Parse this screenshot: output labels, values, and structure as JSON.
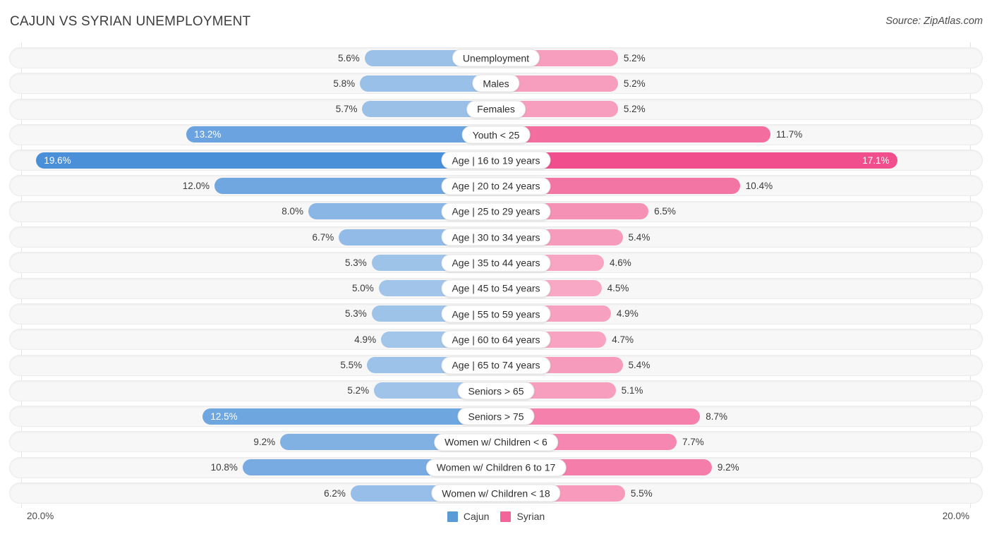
{
  "header": {
    "title": "CAJUN VS SYRIAN UNEMPLOYMENT",
    "source": "Source: ZipAtlas.com"
  },
  "axis": {
    "left_tick": "20.0%",
    "right_tick": "20.0%",
    "max": 20.0
  },
  "legend": {
    "items": [
      {
        "label": "Cajun",
        "color": "#5B9BD5"
      },
      {
        "label": "Syrian",
        "color": "#F2659B"
      }
    ]
  },
  "chart_data": {
    "type": "bar",
    "title": "CAJUN VS SYRIAN UNEMPLOYMENT",
    "subtitle": "Source: ZipAtlas.com",
    "orientation": "horizontal-diverging",
    "xlabel": "",
    "ylabel": "",
    "xlim": [
      0,
      20
    ],
    "axis_ticks": [
      "20.0%",
      "20.0%"
    ],
    "grid": false,
    "legend_position": "bottom-center",
    "categories": [
      "Unemployment",
      "Males",
      "Females",
      "Youth < 25",
      "Age | 16 to 19 years",
      "Age | 20 to 24 years",
      "Age | 25 to 29 years",
      "Age | 30 to 34 years",
      "Age | 35 to 44 years",
      "Age | 45 to 54 years",
      "Age | 55 to 59 years",
      "Age | 60 to 64 years",
      "Age | 65 to 74 years",
      "Seniors > 65",
      "Seniors > 75",
      "Women w/ Children < 6",
      "Women w/ Children 6 to 17",
      "Women w/ Children < 18"
    ],
    "series": [
      {
        "name": "Cajun",
        "color": "#5B9BD5",
        "values": [
          5.6,
          5.8,
          5.7,
          13.2,
          19.6,
          12.0,
          8.0,
          6.7,
          5.3,
          5.0,
          5.3,
          4.9,
          5.5,
          5.2,
          12.5,
          9.2,
          10.8,
          6.2
        ],
        "labels": [
          "5.6%",
          "5.8%",
          "5.7%",
          "13.2%",
          "19.6%",
          "12.0%",
          "8.0%",
          "6.7%",
          "5.3%",
          "5.0%",
          "5.3%",
          "4.9%",
          "5.5%",
          "5.2%",
          "12.5%",
          "9.2%",
          "10.8%",
          "6.2%"
        ]
      },
      {
        "name": "Syrian",
        "color": "#F2659B",
        "values": [
          5.2,
          5.2,
          5.2,
          11.7,
          17.1,
          10.4,
          6.5,
          5.4,
          4.6,
          4.5,
          4.9,
          4.7,
          5.4,
          5.1,
          8.7,
          7.7,
          9.2,
          5.5
        ],
        "labels": [
          "5.2%",
          "5.2%",
          "5.2%",
          "11.7%",
          "17.1%",
          "10.4%",
          "6.5%",
          "5.4%",
          "4.6%",
          "4.5%",
          "4.9%",
          "4.7%",
          "5.4%",
          "5.1%",
          "8.7%",
          "7.7%",
          "9.2%",
          "5.5%"
        ]
      }
    ]
  },
  "rows": [
    {
      "label": "Unemployment",
      "left": "5.6%",
      "right": "5.2%",
      "left_val": 5.6,
      "right_val": 5.2,
      "left_inside": false,
      "right_inside": false
    },
    {
      "label": "Males",
      "left": "5.8%",
      "right": "5.2%",
      "left_val": 5.8,
      "right_val": 5.2,
      "left_inside": false,
      "right_inside": false
    },
    {
      "label": "Females",
      "left": "5.7%",
      "right": "5.2%",
      "left_val": 5.7,
      "right_val": 5.2,
      "left_inside": false,
      "right_inside": false
    },
    {
      "label": "Youth < 25",
      "left": "13.2%",
      "right": "11.7%",
      "left_val": 13.2,
      "right_val": 11.7,
      "left_inside": true,
      "right_inside": false
    },
    {
      "label": "Age | 16 to 19 years",
      "left": "19.6%",
      "right": "17.1%",
      "left_val": 19.6,
      "right_val": 17.1,
      "left_inside": true,
      "right_inside": true
    },
    {
      "label": "Age | 20 to 24 years",
      "left": "12.0%",
      "right": "10.4%",
      "left_val": 12.0,
      "right_val": 10.4,
      "left_inside": false,
      "right_inside": false
    },
    {
      "label": "Age | 25 to 29 years",
      "left": "8.0%",
      "right": "6.5%",
      "left_val": 8.0,
      "right_val": 6.5,
      "left_inside": false,
      "right_inside": false
    },
    {
      "label": "Age | 30 to 34 years",
      "left": "6.7%",
      "right": "5.4%",
      "left_val": 6.7,
      "right_val": 5.4,
      "left_inside": false,
      "right_inside": false
    },
    {
      "label": "Age | 35 to 44 years",
      "left": "5.3%",
      "right": "4.6%",
      "left_val": 5.3,
      "right_val": 4.6,
      "left_inside": false,
      "right_inside": false
    },
    {
      "label": "Age | 45 to 54 years",
      "left": "5.0%",
      "right": "4.5%",
      "left_val": 5.0,
      "right_val": 4.5,
      "left_inside": false,
      "right_inside": false
    },
    {
      "label": "Age | 55 to 59 years",
      "left": "5.3%",
      "right": "4.9%",
      "left_val": 5.3,
      "right_val": 4.9,
      "left_inside": false,
      "right_inside": false
    },
    {
      "label": "Age | 60 to 64 years",
      "left": "4.9%",
      "right": "4.7%",
      "left_val": 4.9,
      "right_val": 4.7,
      "left_inside": false,
      "right_inside": false
    },
    {
      "label": "Age | 65 to 74 years",
      "left": "5.5%",
      "right": "5.4%",
      "left_val": 5.5,
      "right_val": 5.4,
      "left_inside": false,
      "right_inside": false
    },
    {
      "label": "Seniors > 65",
      "left": "5.2%",
      "right": "5.1%",
      "left_val": 5.2,
      "right_val": 5.1,
      "left_inside": false,
      "right_inside": false
    },
    {
      "label": "Seniors > 75",
      "left": "12.5%",
      "right": "8.7%",
      "left_val": 12.5,
      "right_val": 8.7,
      "left_inside": true,
      "right_inside": false
    },
    {
      "label": "Women w/ Children < 6",
      "left": "9.2%",
      "right": "7.7%",
      "left_val": 9.2,
      "right_val": 7.7,
      "left_inside": false,
      "right_inside": false
    },
    {
      "label": "Women w/ Children 6 to 17",
      "left": "10.8%",
      "right": "9.2%",
      "left_val": 10.8,
      "right_val": 9.2,
      "left_inside": false,
      "right_inside": false
    },
    {
      "label": "Women w/ Children < 18",
      "left": "6.2%",
      "right": "5.5%",
      "left_val": 6.2,
      "right_val": 5.5,
      "left_inside": false,
      "right_inside": false
    }
  ]
}
